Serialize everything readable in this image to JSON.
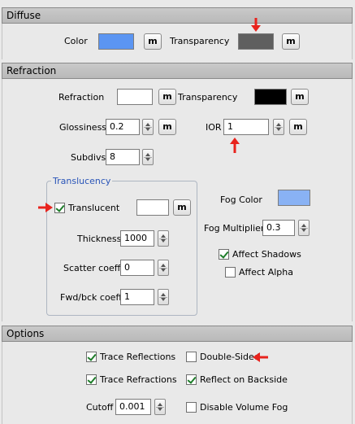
{
  "sections": {
    "diffuse": {
      "title": "Diffuse",
      "color_label": "Color",
      "color_value": "#5b95f2",
      "transparency_label": "Transparency",
      "transparency_value": "#5f5f5f",
      "map_button_label": "m"
    },
    "refraction": {
      "title": "Refraction",
      "refraction_label": "Refraction",
      "refraction_color": "#ffffff",
      "transparency_label": "Transparency",
      "transparency_color": "#000000",
      "glossiness_label": "Glossiness",
      "glossiness_value": "0.2",
      "ior_label": "IOR",
      "ior_value": "1",
      "subdivs_label": "Subdivs",
      "subdivs_value": "8",
      "map_button_label": "m",
      "translucency": {
        "group_title": "Translucency",
        "translucent_label": "Translucent",
        "translucent_checked": true,
        "translucent_color": "#ffffff",
        "thickness_label": "Thickness",
        "thickness_value": "1000",
        "scatter_label": "Scatter coeff",
        "scatter_value": "0",
        "fwdbck_label": "Fwd/bck coeff",
        "fwdbck_value": "1"
      },
      "fog_color_label": "Fog Color",
      "fog_color_value": "#89b2f4",
      "fog_multiplier_label": "Fog Multiplier",
      "fog_multiplier_value": "0.3",
      "affect_shadows_label": "Affect Shadows",
      "affect_shadows_checked": true,
      "affect_alpha_label": "Affect Alpha",
      "affect_alpha_checked": false
    },
    "options": {
      "title": "Options",
      "trace_reflections_label": "Trace Reflections",
      "trace_reflections_checked": true,
      "double_sided_label": "Double-Sided",
      "double_sided_checked": false,
      "trace_refractions_label": "Trace Refractions",
      "trace_refractions_checked": true,
      "reflect_backside_label": "Reflect on Backside",
      "reflect_backside_checked": true,
      "cutoff_label": "Cutoff",
      "cutoff_value": "0.001",
      "disable_volume_fog_label": "Disable Volume Fog",
      "disable_volume_fog_checked": false
    }
  },
  "annotation_color": "#e8231d"
}
